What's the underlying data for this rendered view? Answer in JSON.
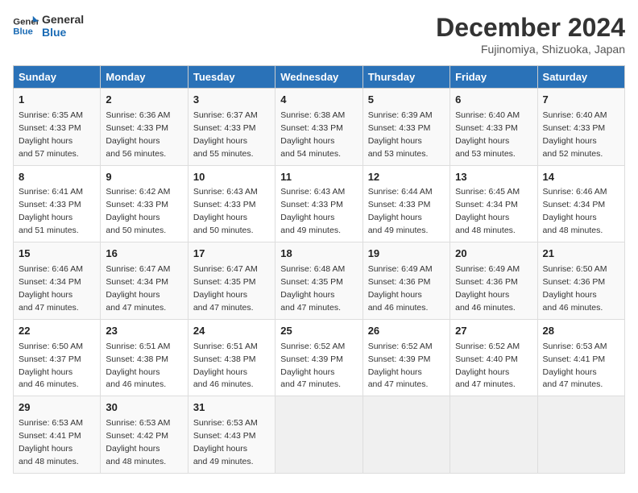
{
  "header": {
    "logo_line1": "General",
    "logo_line2": "Blue",
    "month_year": "December 2024",
    "location": "Fujinomiya, Shizuoka, Japan"
  },
  "days_of_week": [
    "Sunday",
    "Monday",
    "Tuesday",
    "Wednesday",
    "Thursday",
    "Friday",
    "Saturday"
  ],
  "weeks": [
    [
      {
        "day": "1",
        "sunrise": "6:35 AM",
        "sunset": "4:33 PM",
        "daylight": "9 hours and 57 minutes."
      },
      {
        "day": "2",
        "sunrise": "6:36 AM",
        "sunset": "4:33 PM",
        "daylight": "9 hours and 56 minutes."
      },
      {
        "day": "3",
        "sunrise": "6:37 AM",
        "sunset": "4:33 PM",
        "daylight": "9 hours and 55 minutes."
      },
      {
        "day": "4",
        "sunrise": "6:38 AM",
        "sunset": "4:33 PM",
        "daylight": "9 hours and 54 minutes."
      },
      {
        "day": "5",
        "sunrise": "6:39 AM",
        "sunset": "4:33 PM",
        "daylight": "9 hours and 53 minutes."
      },
      {
        "day": "6",
        "sunrise": "6:40 AM",
        "sunset": "4:33 PM",
        "daylight": "9 hours and 53 minutes."
      },
      {
        "day": "7",
        "sunrise": "6:40 AM",
        "sunset": "4:33 PM",
        "daylight": "9 hours and 52 minutes."
      }
    ],
    [
      {
        "day": "8",
        "sunrise": "6:41 AM",
        "sunset": "4:33 PM",
        "daylight": "9 hours and 51 minutes."
      },
      {
        "day": "9",
        "sunrise": "6:42 AM",
        "sunset": "4:33 PM",
        "daylight": "9 hours and 50 minutes."
      },
      {
        "day": "10",
        "sunrise": "6:43 AM",
        "sunset": "4:33 PM",
        "daylight": "9 hours and 50 minutes."
      },
      {
        "day": "11",
        "sunrise": "6:43 AM",
        "sunset": "4:33 PM",
        "daylight": "9 hours and 49 minutes."
      },
      {
        "day": "12",
        "sunrise": "6:44 AM",
        "sunset": "4:33 PM",
        "daylight": "9 hours and 49 minutes."
      },
      {
        "day": "13",
        "sunrise": "6:45 AM",
        "sunset": "4:34 PM",
        "daylight": "9 hours and 48 minutes."
      },
      {
        "day": "14",
        "sunrise": "6:46 AM",
        "sunset": "4:34 PM",
        "daylight": "9 hours and 48 minutes."
      }
    ],
    [
      {
        "day": "15",
        "sunrise": "6:46 AM",
        "sunset": "4:34 PM",
        "daylight": "9 hours and 47 minutes."
      },
      {
        "day": "16",
        "sunrise": "6:47 AM",
        "sunset": "4:34 PM",
        "daylight": "9 hours and 47 minutes."
      },
      {
        "day": "17",
        "sunrise": "6:47 AM",
        "sunset": "4:35 PM",
        "daylight": "9 hours and 47 minutes."
      },
      {
        "day": "18",
        "sunrise": "6:48 AM",
        "sunset": "4:35 PM",
        "daylight": "9 hours and 47 minutes."
      },
      {
        "day": "19",
        "sunrise": "6:49 AM",
        "sunset": "4:36 PM",
        "daylight": "9 hours and 46 minutes."
      },
      {
        "day": "20",
        "sunrise": "6:49 AM",
        "sunset": "4:36 PM",
        "daylight": "9 hours and 46 minutes."
      },
      {
        "day": "21",
        "sunrise": "6:50 AM",
        "sunset": "4:36 PM",
        "daylight": "9 hours and 46 minutes."
      }
    ],
    [
      {
        "day": "22",
        "sunrise": "6:50 AM",
        "sunset": "4:37 PM",
        "daylight": "9 hours and 46 minutes."
      },
      {
        "day": "23",
        "sunrise": "6:51 AM",
        "sunset": "4:38 PM",
        "daylight": "9 hours and 46 minutes."
      },
      {
        "day": "24",
        "sunrise": "6:51 AM",
        "sunset": "4:38 PM",
        "daylight": "9 hours and 46 minutes."
      },
      {
        "day": "25",
        "sunrise": "6:52 AM",
        "sunset": "4:39 PM",
        "daylight": "9 hours and 47 minutes."
      },
      {
        "day": "26",
        "sunrise": "6:52 AM",
        "sunset": "4:39 PM",
        "daylight": "9 hours and 47 minutes."
      },
      {
        "day": "27",
        "sunrise": "6:52 AM",
        "sunset": "4:40 PM",
        "daylight": "9 hours and 47 minutes."
      },
      {
        "day": "28",
        "sunrise": "6:53 AM",
        "sunset": "4:41 PM",
        "daylight": "9 hours and 47 minutes."
      }
    ],
    [
      {
        "day": "29",
        "sunrise": "6:53 AM",
        "sunset": "4:41 PM",
        "daylight": "9 hours and 48 minutes."
      },
      {
        "day": "30",
        "sunrise": "6:53 AM",
        "sunset": "4:42 PM",
        "daylight": "9 hours and 48 minutes."
      },
      {
        "day": "31",
        "sunrise": "6:53 AM",
        "sunset": "4:43 PM",
        "daylight": "9 hours and 49 minutes."
      },
      null,
      null,
      null,
      null
    ]
  ],
  "labels": {
    "sunrise": "Sunrise: ",
    "sunset": "Sunset: ",
    "daylight": "Daylight hours"
  }
}
